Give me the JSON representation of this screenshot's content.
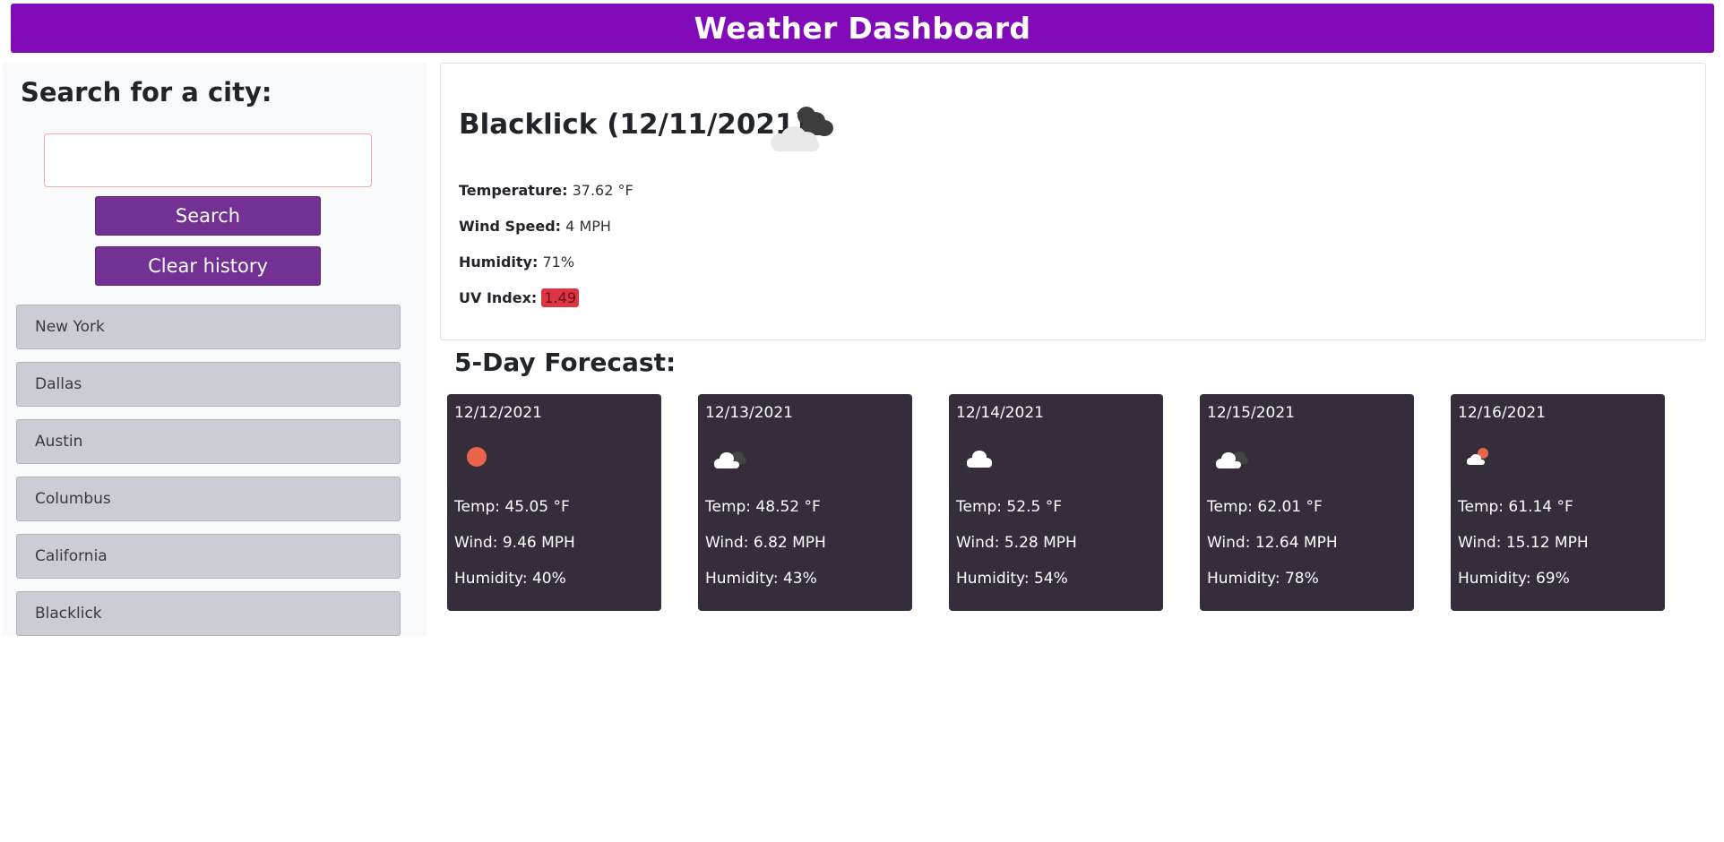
{
  "header": {
    "title": "Weather Dashboard"
  },
  "colors": {
    "header": "#820bb9",
    "button": "#743194",
    "card": "#352d3a",
    "uv": "#dc3545"
  },
  "search": {
    "heading": "Search for a city:",
    "value": "",
    "search_label": "Search",
    "clear_label": "Clear history"
  },
  "history": [
    {
      "label": "New York"
    },
    {
      "label": "Dallas"
    },
    {
      "label": "Austin"
    },
    {
      "label": "Columbus"
    },
    {
      "label": "California"
    },
    {
      "label": "Blacklick"
    }
  ],
  "current": {
    "title": "Blacklick (12/11/2021)",
    "icon": "broken-clouds-icon",
    "temperature_label": "Temperature:",
    "temperature": "37.62 °F",
    "wind_label": "Wind Speed:",
    "wind": "4 MPH",
    "humidity_label": "Humidity:",
    "humidity": "71%",
    "uv_label": "UV Index:",
    "uv": "1.49"
  },
  "forecast": {
    "heading": "5-Day Forecast:",
    "days": [
      {
        "date": "12/12/2021",
        "icon": "sun-icon",
        "temp": "Temp: 45.05 °F",
        "wind": "Wind: 9.46 MPH",
        "humidity": "Humidity: 40%"
      },
      {
        "date": "12/13/2021",
        "icon": "broken-clouds-icon",
        "temp": "Temp: 48.52 °F",
        "wind": "Wind: 6.82 MPH",
        "humidity": "Humidity: 43%"
      },
      {
        "date": "12/14/2021",
        "icon": "cloud-icon",
        "temp": "Temp: 52.5 °F",
        "wind": "Wind: 5.28 MPH",
        "humidity": "Humidity: 54%"
      },
      {
        "date": "12/15/2021",
        "icon": "broken-clouds-icon",
        "temp": "Temp: 62.01 °F",
        "wind": "Wind: 12.64 MPH",
        "humidity": "Humidity: 78%"
      },
      {
        "date": "12/16/2021",
        "icon": "partly-cloudy-icon",
        "temp": "Temp: 61.14 °F",
        "wind": "Wind: 15.12 MPH",
        "humidity": "Humidity: 69%"
      }
    ]
  }
}
